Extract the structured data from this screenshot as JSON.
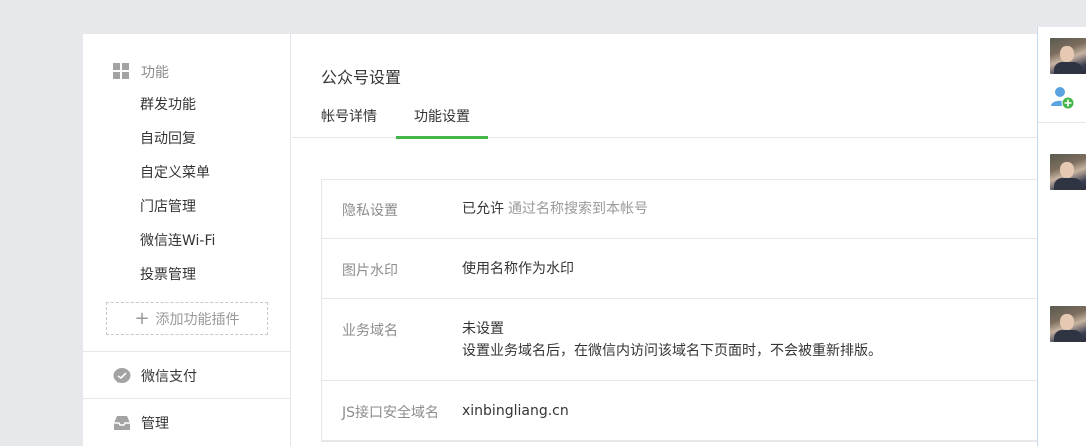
{
  "sidebar": {
    "function_head": "功能",
    "items": [
      {
        "label": "群发功能"
      },
      {
        "label": "自动回复"
      },
      {
        "label": "自定义菜单"
      },
      {
        "label": "门店管理"
      },
      {
        "label": "微信连Wi-Fi"
      },
      {
        "label": "投票管理"
      }
    ],
    "add_plugin_label": "添加功能插件",
    "wechat_pay": "微信支付",
    "manage": "管理"
  },
  "main": {
    "title": "公众号设置",
    "tabs": [
      {
        "label": "帐号详情",
        "active": false
      },
      {
        "label": "功能设置",
        "active": true
      }
    ],
    "settings": [
      {
        "label": "隐私设置",
        "value": "已允许",
        "hint": "通过名称搜索到本帐号"
      },
      {
        "label": "图片水印",
        "value": "使用名称作为水印"
      },
      {
        "label": "业务域名",
        "value": "未设置",
        "desc": "设置业务域名后，在微信内访问该域名下页面时，不会被重新排版。"
      },
      {
        "label": "JS接口安全域名",
        "value": "xinbingliang.cn"
      }
    ]
  },
  "colors": {
    "accent_green": "#44b549",
    "background": "#e7e8eb",
    "border": "#e7e7eb"
  }
}
